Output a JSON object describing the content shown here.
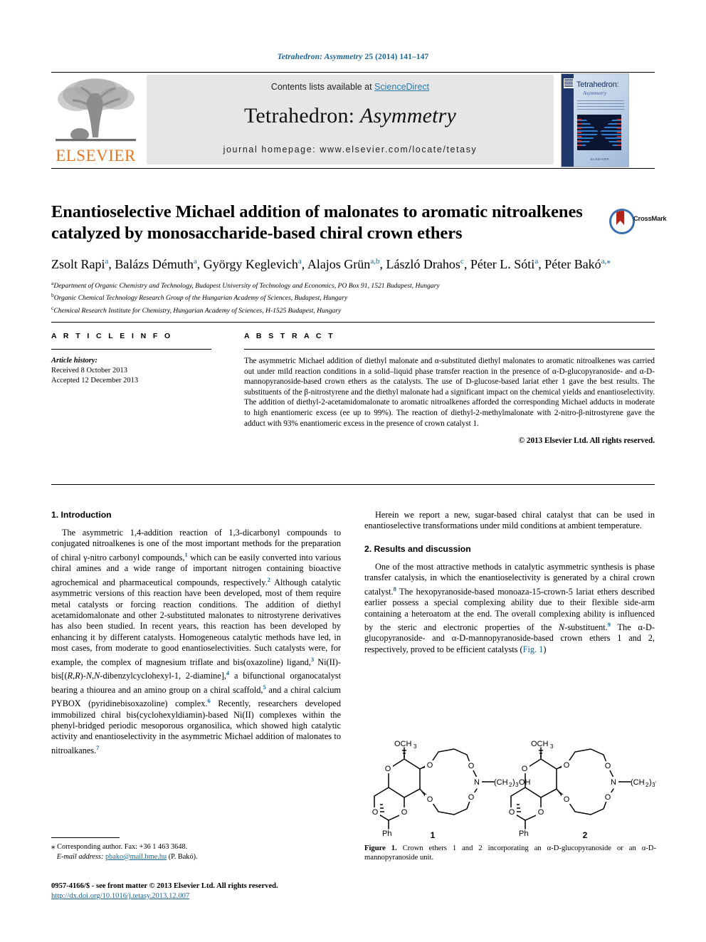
{
  "running_head": {
    "journal": "Tetrahedron: Asymmetry",
    "citation": " 25 (2014) 141–147"
  },
  "masthead": {
    "publisher": "ELSEVIER",
    "contents_text": "Contents lists available at ",
    "sciencedirect": "ScienceDirect",
    "journal_title_plain": "Tetrahedron: ",
    "journal_title_italic": "Asymmetry",
    "homepage": "journal homepage: www.elsevier.com/locate/tetasy",
    "cover_title": "Tetrahedron:",
    "cover_subtitle": "Asymmetry",
    "cover_footer": "ELSEVIER"
  },
  "article": {
    "title": "Enantioselective Michael addition of malonates to aromatic nitroalkenes catalyzed by monosaccharide-based chiral crown ethers",
    "crossmark_label": "CrossMark",
    "authors": [
      {
        "name": "Zsolt Rapi",
        "sup": "a"
      },
      {
        "name": "Balázs Démuth",
        "sup": "a"
      },
      {
        "name": "György Keglevich",
        "sup": "a"
      },
      {
        "name": "Alajos Grün",
        "sup": "a,b"
      },
      {
        "name": "László Drahos",
        "sup": "c"
      },
      {
        "name": "Péter L. Sóti",
        "sup": "a"
      },
      {
        "name": "Péter Bakó",
        "sup": "a,⁎"
      }
    ],
    "affiliations": [
      {
        "mark": "a",
        "text": "Department of Organic Chemistry and Technology, Budapest University of Technology and Economics, PO Box 91, 1521 Budapest, Hungary"
      },
      {
        "mark": "b",
        "text": "Organic Chemical Technology Research Group of the Hungarian Academy of Sciences, Budapest, Hungary"
      },
      {
        "mark": "c",
        "text": "Chemical Research Institute for Chemistry, Hungarian Academy of Sciences, H-1525 Budapest, Hungary"
      }
    ]
  },
  "article_info": {
    "heading": "A R T I C L E   I N F O",
    "history_label": "Article history:",
    "received": "Received 8 October 2013",
    "accepted": "Accepted 12 December 2013"
  },
  "abstract": {
    "heading": "A B S T R A C T",
    "text": "The asymmetric Michael addition of diethyl malonate and α-substituted diethyl malonates to aromatic nitroalkenes was carried out under mild reaction conditions in a solid–liquid phase transfer reaction in the presence of α-D-glucopyranoside- and α-D-mannopyranoside-based crown ethers as the catalysts. The use of D-glucose-based lariat ether 1 gave the best results. The substituents of the β-nitrostyrene and the diethyl malonate had a significant impact on the chemical yields and enantioselectivity. The addition of diethyl-2-acetamidomalonate to aromatic nitroalkenes afforded the corresponding Michael adducts in moderate to high enantiomeric excess (ee up to 99%). The reaction of diethyl-2-methylmalonate with 2-nitro-β-nitrostyrene gave the adduct with 93% enantiomeric excess in the presence of crown catalyst 1.",
    "copyright": "© 2013 Elsevier Ltd. All rights reserved."
  },
  "body": {
    "section1_heading": "1. Introduction",
    "section1_para1": "The asymmetric 1,4-addition reaction of 1,3-dicarbonyl compounds to conjugated nitroalkenes is one of the most important methods for the preparation of chiral γ-nitro carbonyl compounds,|1| which can be easily converted into various chiral amines and a wide range of important nitrogen containing bioactive agrochemical and pharmaceutical compounds, respectively.|2| Although catalytic asymmetric versions of this reaction have been developed, most of them require metal catalysts or forcing reaction conditions. The addition of diethyl acetamidomalonate and other 2-substituted malonates to nitrostyrene derivatives has also been studied. In recent years, this reaction has been developed by enhancing it by different catalysts. Homogeneous catalytic methods have led, in most cases, from moderate to good enantioselectivities. Such catalysts were, for example, the complex of magnesium triflate and bis(oxazoline) ligand,|3| Ni(II)-bis[(R,R)-N,N-dibenzylcyclohexyl-1, 2-diamine],|4| a bifunctional organocatalyst bearing a thiourea and an amino group on a chiral scaffold,|5| and a chiral calcium PYBOX (pyridinebisoxazoline) complex.|6| Recently, researchers developed immobilized chiral bis(cyclohexyldiamin)-based Ni(II) complexes within the phenyl-bridged periodic mesoporous organosilica, which showed high catalytic activity and enantioselectivity in the asymmetric Michael addition of malonates to nitroalkanes.|7|",
    "right_para1": "Herein we report a new, sugar-based chiral catalyst that can be used in enantioselective transformations under mild conditions at ambient temperature.",
    "section2_heading": "2. Results and discussion",
    "right_para2": "One of the most attractive methods in catalytic asymmetric synthesis is phase transfer catalysis, in which the enantioselectivity is generated by a chiral crown catalyst.|8| The hexopyranoside-based monoaza-15-crown-5 lariat ethers described earlier possess a special complexing ability due to their flexible side-arm containing a heteroatom at the end. The overall complexing ability is influenced by the steric and electronic properties of the N-substituent.|9| The α-D-glucopyranoside- and α-D-mannopyranoside-based crown ethers 1 and 2, respectively, proved to be efficient catalysts (Fig. 1)"
  },
  "figure": {
    "caption_bold": "Figure 1.",
    "caption_text": " Crown ethers 1 and 2 incorporating an α-D-glucopyranoside or an α-D-mannopyranoside unit.",
    "structure1_label": "1",
    "structure2_label": "2",
    "labels": {
      "och3": "OCH",
      "och3_sub": "3",
      "o": "O",
      "n": "N",
      "sidechain": "(CH",
      "sidechain_sub": "2",
      "sidechain_tail": ")",
      "sidechain_sub2": "3",
      "sidechain_end": "OH",
      "ph": "Ph"
    }
  },
  "footnote": {
    "star": "⁎",
    "corresponding": " Corresponding author. Fax: +36 1 463 3648.",
    "email_label": "E-mail address:",
    "email": "pbako@mail.bme.hu",
    "email_owner": " (P. Bakó)."
  },
  "issn": {
    "line1": "0957-4166/$ - see front matter © 2013 Elsevier Ltd. All rights reserved.",
    "doi": "http://dx.doi.org/10.1016/j.tetasy.2013.12.007"
  },
  "colors": {
    "link": "#1a6496",
    "elsevier_orange": "#E87722",
    "sciencedirect": "#2a7ab0",
    "crossmark_blue": "#3a6fb0",
    "crossmark_red": "#b32317"
  }
}
